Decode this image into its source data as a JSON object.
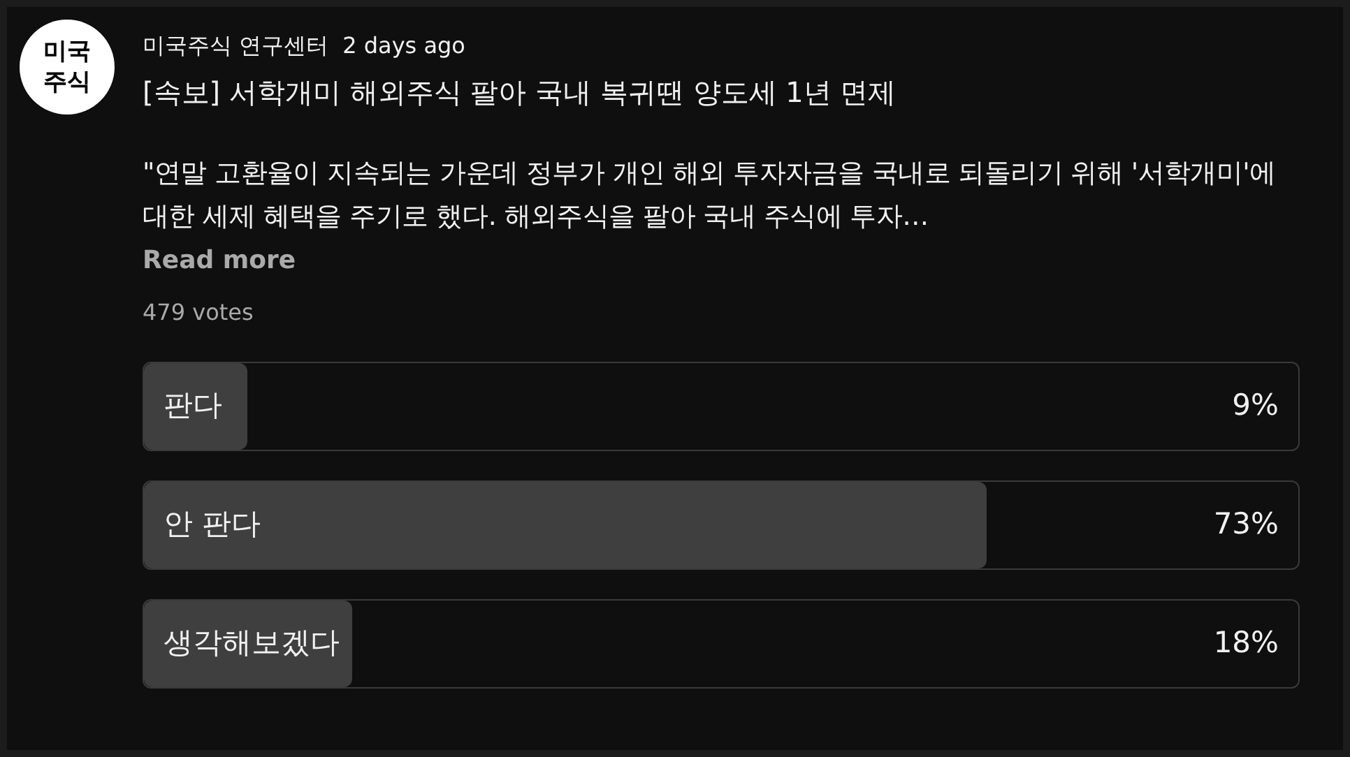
{
  "avatar": {
    "lines": [
      "미국",
      "주식"
    ]
  },
  "post": {
    "author": "미국주식 연구센터",
    "time": "2 days ago",
    "title": "[속보] 서학개미 해외주식 팔아 국내 복귀땐 양도세 1년 면제",
    "body": "\"연말 고환율이 지속되는 가운데 정부가 개인 해외 투자자금을 국내로 되돌리기 위해 '서학개미'에 대한 세제 혜택을 주기로 했다. 해외주식을 팔아 국내 주식에 투자…",
    "read_more": "Read more",
    "votes": "479 votes"
  },
  "poll": {
    "options": [
      {
        "label": "판다",
        "percent": "9%",
        "level": 0.09
      },
      {
        "label": "안 판다",
        "percent": "73%",
        "level": 0.73
      },
      {
        "label": "생각해보겠다",
        "percent": "18%",
        "level": 0.18
      }
    ]
  }
}
